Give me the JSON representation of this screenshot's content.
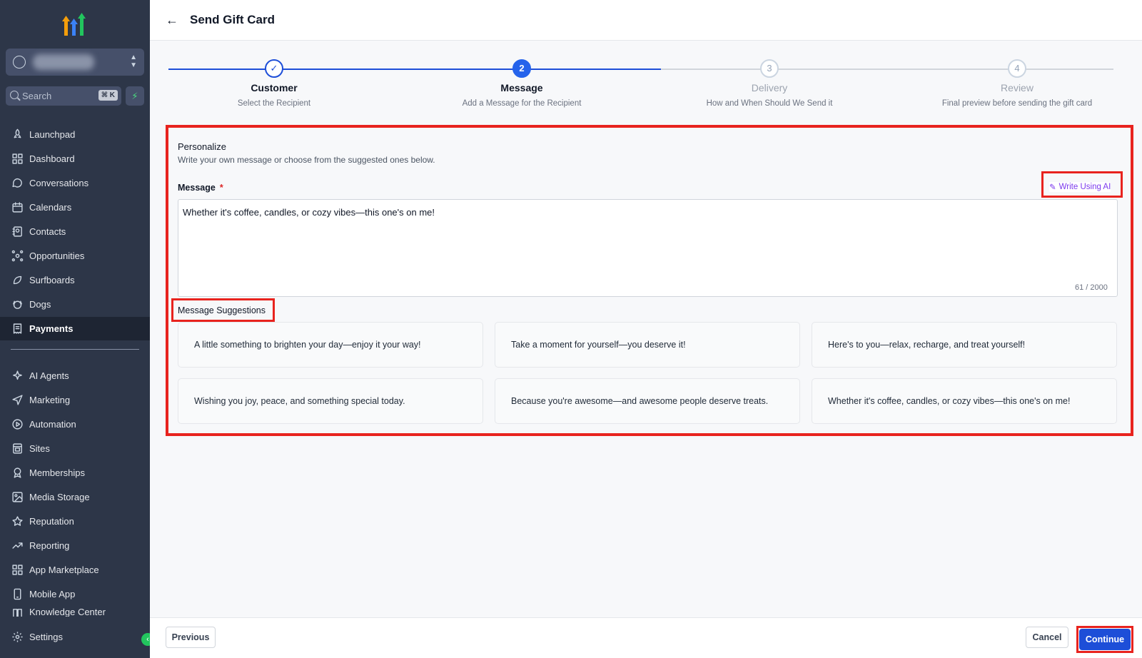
{
  "header": {
    "title": "Send Gift Card"
  },
  "sidebar": {
    "search_label": "Search",
    "search_shortcut": "⌘ K",
    "items": [
      {
        "label": "Launchpad",
        "icon": "rocket-icon"
      },
      {
        "label": "Dashboard",
        "icon": "grid-icon"
      },
      {
        "label": "Conversations",
        "icon": "chat-icon"
      },
      {
        "label": "Calendars",
        "icon": "calendar-icon"
      },
      {
        "label": "Contacts",
        "icon": "contacts-icon"
      },
      {
        "label": "Opportunities",
        "icon": "network-icon"
      },
      {
        "label": "Surfboards",
        "icon": "surfboard-icon"
      },
      {
        "label": "Dogs",
        "icon": "dog-icon"
      },
      {
        "label": "Payments",
        "icon": "receipt-icon"
      }
    ],
    "items2": [
      {
        "label": "AI Agents",
        "icon": "sparkle-icon"
      },
      {
        "label": "Marketing",
        "icon": "send-icon"
      },
      {
        "label": "Automation",
        "icon": "automation-icon"
      },
      {
        "label": "Sites",
        "icon": "sites-icon"
      },
      {
        "label": "Memberships",
        "icon": "award-icon"
      },
      {
        "label": "Media Storage",
        "icon": "image-icon"
      },
      {
        "label": "Reputation",
        "icon": "star-icon"
      },
      {
        "label": "Reporting",
        "icon": "trend-icon"
      },
      {
        "label": "App Marketplace",
        "icon": "apps-icon"
      },
      {
        "label": "Mobile App",
        "icon": "phone-icon"
      },
      {
        "label": "Knowledge Center",
        "icon": "book-icon"
      }
    ],
    "settings_label": "Settings"
  },
  "stepper": {
    "steps": [
      {
        "number": "",
        "name": "Customer",
        "desc": "Select the Recipient",
        "state": "done"
      },
      {
        "number": "2",
        "name": "Message",
        "desc": "Add a Message for the Recipient",
        "state": "current"
      },
      {
        "number": "3",
        "name": "Delivery",
        "desc": "How and When Should We Send it",
        "state": "upcoming"
      },
      {
        "number": "4",
        "name": "Review",
        "desc": "Final preview before sending the gift card",
        "state": "upcoming"
      }
    ]
  },
  "form": {
    "section_title": "Personalize",
    "section_subtitle": "Write your own message or choose from the suggested ones below.",
    "message_label": "Message",
    "required_mark": "*",
    "ai_button": "Write Using AI",
    "message_value": "Whether it's coffee, candles, or cozy vibes—this one's on me!",
    "counter": "61 / 2000",
    "suggestions_label": "Message Suggestions",
    "suggestions": [
      "A little something to brighten your day—enjoy it your way!",
      "Take a moment for yourself—you deserve it!",
      "Here's to you—relax, recharge, and treat yourself!",
      "Wishing you joy, peace, and something special today.",
      "Because you're awesome—and awesome people deserve treats.",
      "Whether it's coffee, candles, or cozy vibes—this one's on me!"
    ]
  },
  "footer": {
    "previous": "Previous",
    "cancel": "Cancel",
    "continue": "Continue"
  },
  "colors": {
    "sidebar": "#2d3648",
    "accent": "#1d4ed8",
    "highlight": "#e8231e",
    "ai": "#7c3aed"
  }
}
